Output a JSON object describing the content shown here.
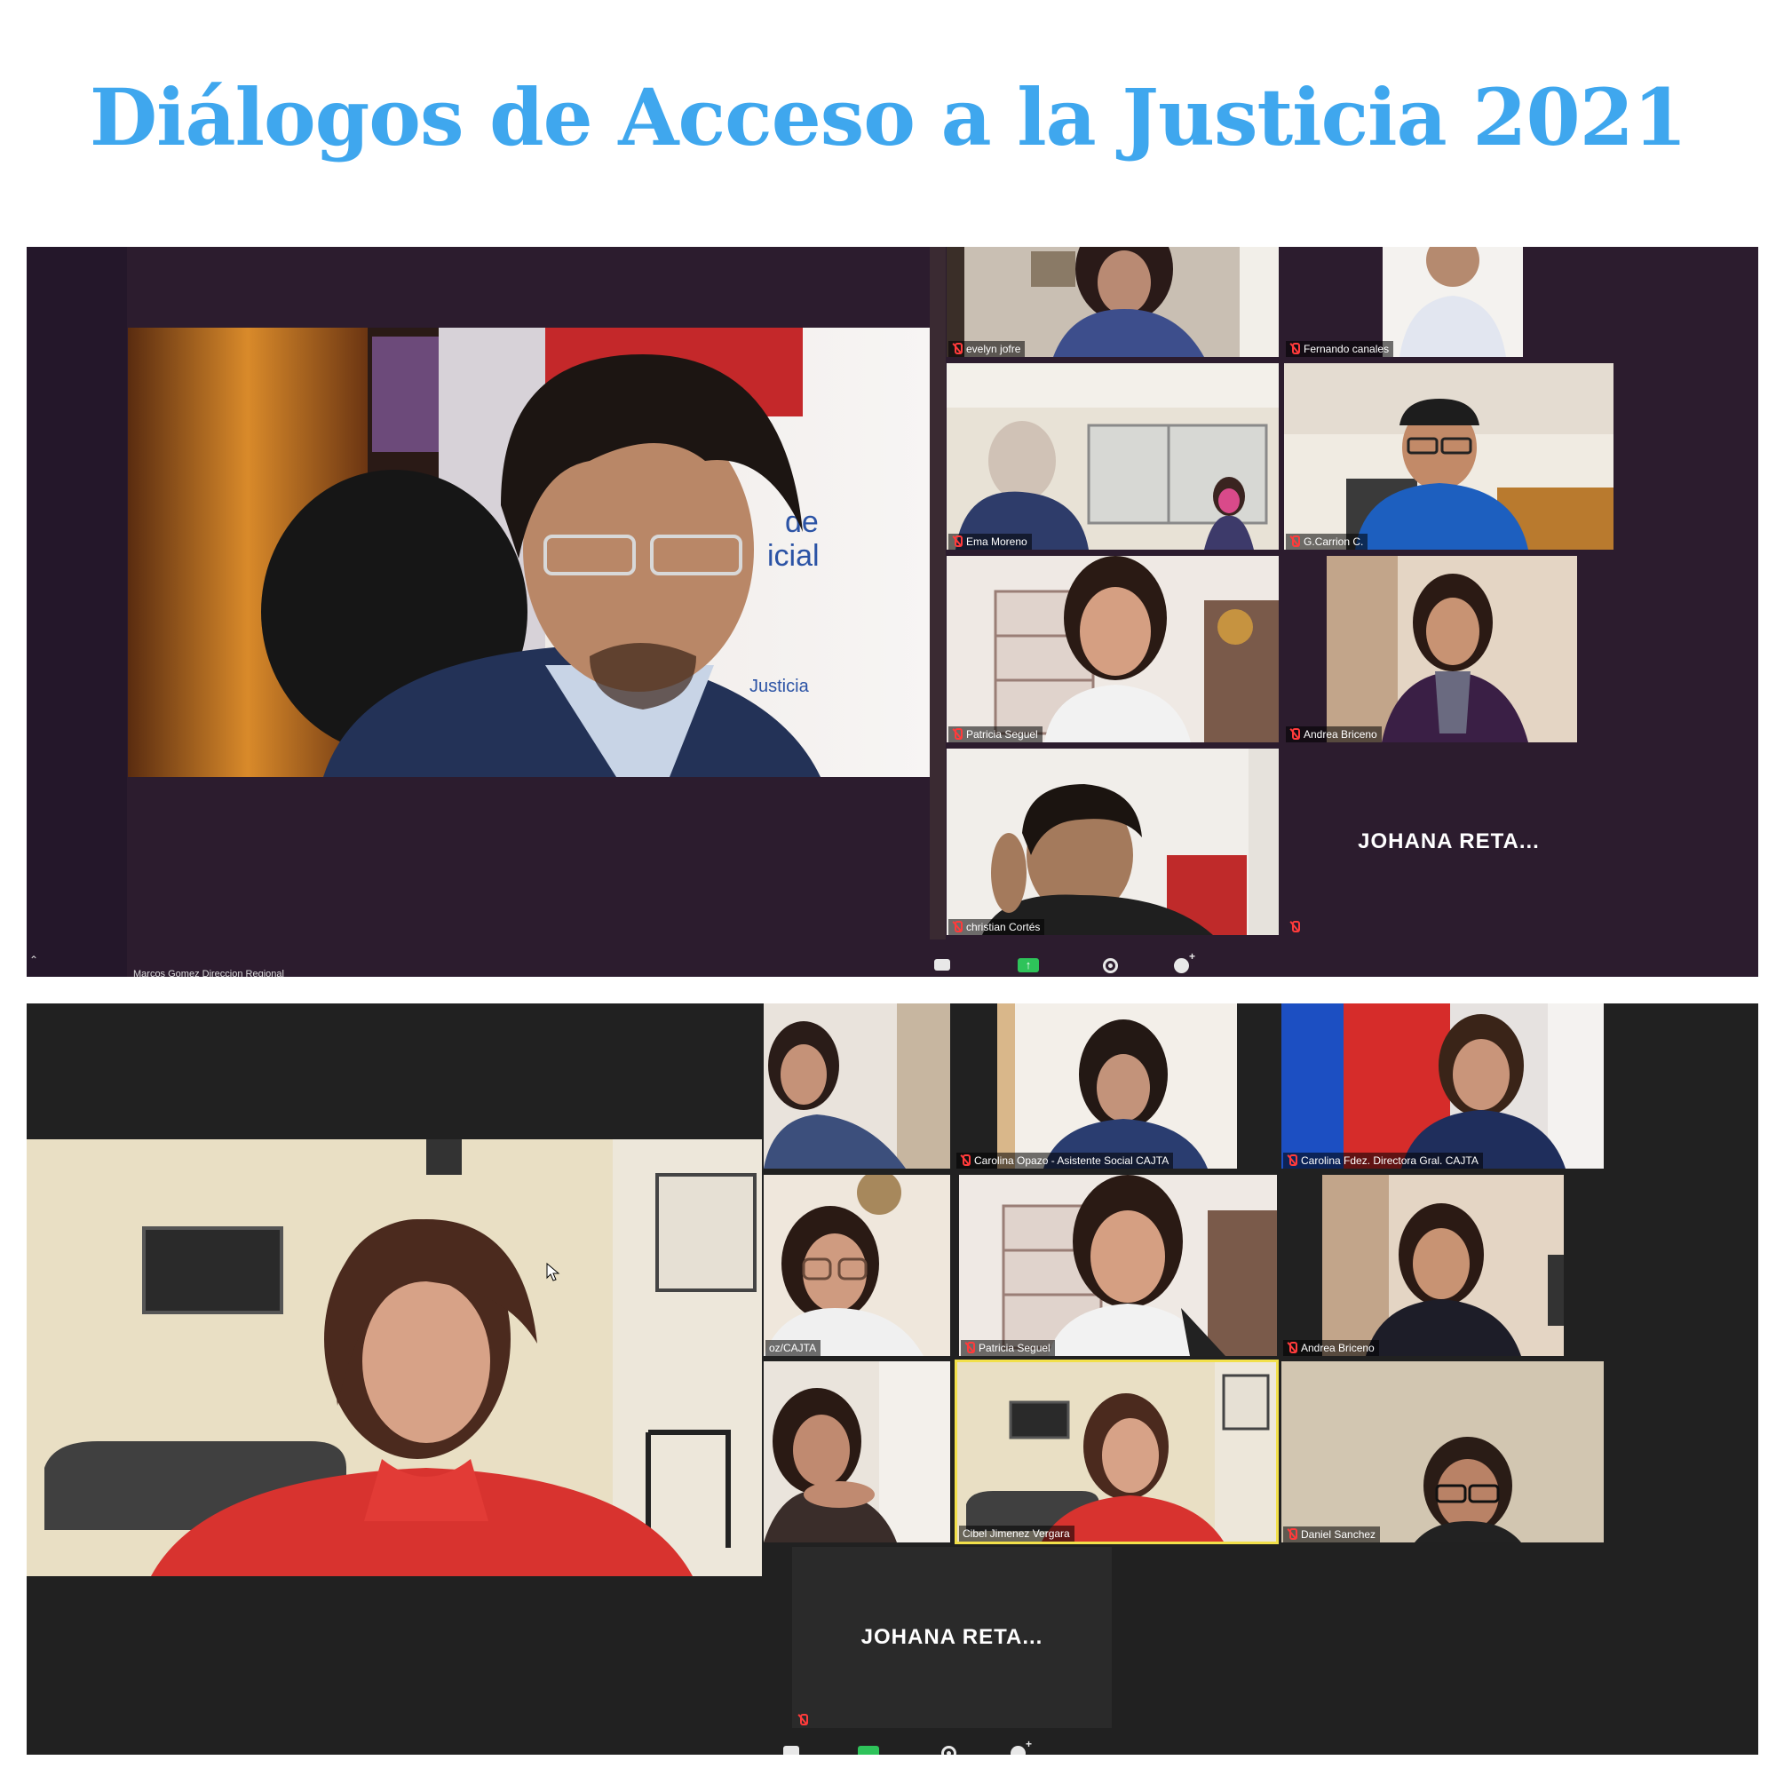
{
  "page": {
    "title": "Diálogos de Acceso a la Justicia 2021"
  },
  "top_meeting": {
    "speaker_label": "Marcos Gomez Direccion Regional",
    "placeholder_name": "JOHANA RETA...",
    "participants": [
      {
        "name": "evelyn jofre"
      },
      {
        "name": "Fernando canales"
      },
      {
        "name": "Ema Moreno"
      },
      {
        "name": "G.Carrion C."
      },
      {
        "name": "Patricia Seguel"
      },
      {
        "name": "Andrea Briceno"
      },
      {
        "name": "christian Cortés"
      }
    ],
    "toolbar_icons": [
      "chat-icon",
      "share-screen-icon",
      "record-icon",
      "reactions-icon"
    ]
  },
  "bottom_meeting": {
    "placeholder_name": "JOHANA RETA...",
    "participants": [
      {
        "name": ""
      },
      {
        "name": "Carolina Opazo - Asistente Social CAJTA"
      },
      {
        "name": "Carolina Fdez. Directora Gral. CAJTA"
      },
      {
        "name": "oz/CAJTA"
      },
      {
        "name": "Patricia Seguel"
      },
      {
        "name": "Andrea Briceno"
      },
      {
        "name": ""
      },
      {
        "name": "Cibel Jimenez Vergara"
      },
      {
        "name": "Daniel Sanchez"
      }
    ],
    "active_speaker_color": "#f2e04a"
  },
  "colors": {
    "title": "#3fa7ee",
    "top_background": "#2c1c2e",
    "bottom_background": "#212121",
    "muted_icon": "#ff3b3b",
    "share_button": "#2ec35a"
  }
}
